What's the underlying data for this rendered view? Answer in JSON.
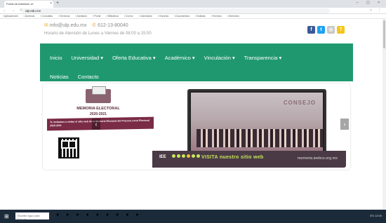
{
  "browser": {
    "tab_title": "Portal de Admisión UI",
    "tab_close": "×",
    "new_tab": "+",
    "window_controls": "– ▢ ×",
    "nav_buttons": "← → ⟳",
    "url": "ulp.edu.mx",
    "extensions": "☆ ⋮",
    "bookmarks": [
      "Aplicaciones",
      "Alumnos",
      "Consultas",
      "Servicios",
      "Admisión",
      "Portal",
      "Biblioteca",
      "Correo",
      "Calendario",
      "Horarios",
      "Documentos",
      "Noticias",
      "Eventos",
      "Directorio"
    ]
  },
  "header": {
    "email_icon": "envelope-icon",
    "email": "info@ulp.edu.mx",
    "phone_icon": "phone-icon",
    "phone": "612-13-80040",
    "hours": "Horario de Atención de Lunes a Viernes de 08:00 a 15:00",
    "socials": [
      {
        "icon": "facebook-icon",
        "glyph": "f",
        "color": "#3b5998"
      },
      {
        "icon": "twitter-icon",
        "glyph": "t",
        "color": "#1da1f2"
      },
      {
        "icon": "instagram-icon",
        "glyph": "◎",
        "color": "#c8c8c8"
      },
      {
        "icon": "help-icon",
        "glyph": "?",
        "color": "#f5c518"
      }
    ]
  },
  "nav": {
    "row1": [
      "Inicio",
      "Universidad ▾",
      "Oferta Educativa ▾",
      "Académico ▾",
      "Vinculación ▾",
      "Transparencia ▾"
    ],
    "row2": [
      "Noticias",
      "Contacto"
    ],
    "accent": "#1f9870"
  },
  "banner": {
    "title": "MEMORIA ELECTORAL",
    "years": "2020-2021",
    "invite": "Te invitamos a visitar el sitio web de la Memoria Electoral del Proceso Local Electoral 2020-2021",
    "consejo": "CONSEJO",
    "logo": "IEE",
    "cta": "VISITA nuestro sitio web",
    "url": "memoria.ieebcs.org.mx",
    "prev": "‹",
    "next": "›",
    "slide_count": 6
  },
  "taskbar": {
    "start": "⊞",
    "search_placeholder": "Escribe aquí para buscar",
    "apps": "● ● ● ● ● ● ● ● ●",
    "tray": "ES  12:00"
  }
}
